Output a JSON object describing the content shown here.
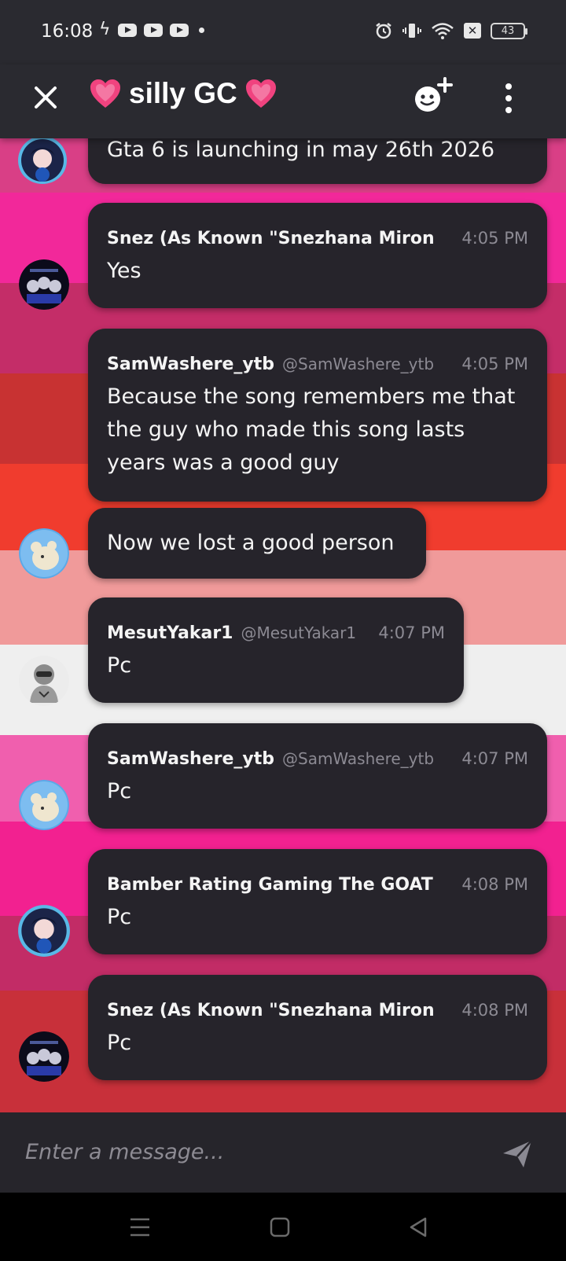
{
  "status_bar": {
    "time": "16:08",
    "battery": "43"
  },
  "header": {
    "title": "silly GC"
  },
  "composer": {
    "placeholder": "Enter a message..."
  },
  "messages": [
    {
      "text": "Gta 6 is launching in may 26th 2026"
    },
    {
      "name": "Snez (As Known \"Snezhana Miron",
      "handle": "",
      "time": "4:05 PM",
      "text": "Yes"
    },
    {
      "name": "SamWashere_ytb",
      "handle": "@SamWashere_ytb",
      "time": "4:05 PM",
      "text": "Because the song remembers me that the guy who made this song lasts years was a good guy"
    },
    {
      "text": "Now we lost a good person"
    },
    {
      "name": "MesutYakar1",
      "handle": "@MesutYakar1",
      "time": "4:07 PM",
      "text": "Pc"
    },
    {
      "name": "SamWashere_ytb",
      "handle": "@SamWashere_ytb",
      "time": "4:07 PM",
      "text": "Pc"
    },
    {
      "name": "Bamber Rating Gaming The GOAT",
      "handle": "",
      "time": "4:08 PM",
      "text": "Pc"
    },
    {
      "name": "Snez (As Known \"Snezhana Miron",
      "handle": "",
      "time": "4:08 PM",
      "text": "Pc"
    }
  ],
  "colors": {
    "header_bg": "#2a2a30",
    "bubble_bg": "#26242b",
    "heart": "#f0437f"
  },
  "icons": [
    "close-icon",
    "heart-icon",
    "add-member-icon",
    "more-vertical-icon",
    "send-icon",
    "menu-icon",
    "home-icon",
    "back-icon"
  ]
}
